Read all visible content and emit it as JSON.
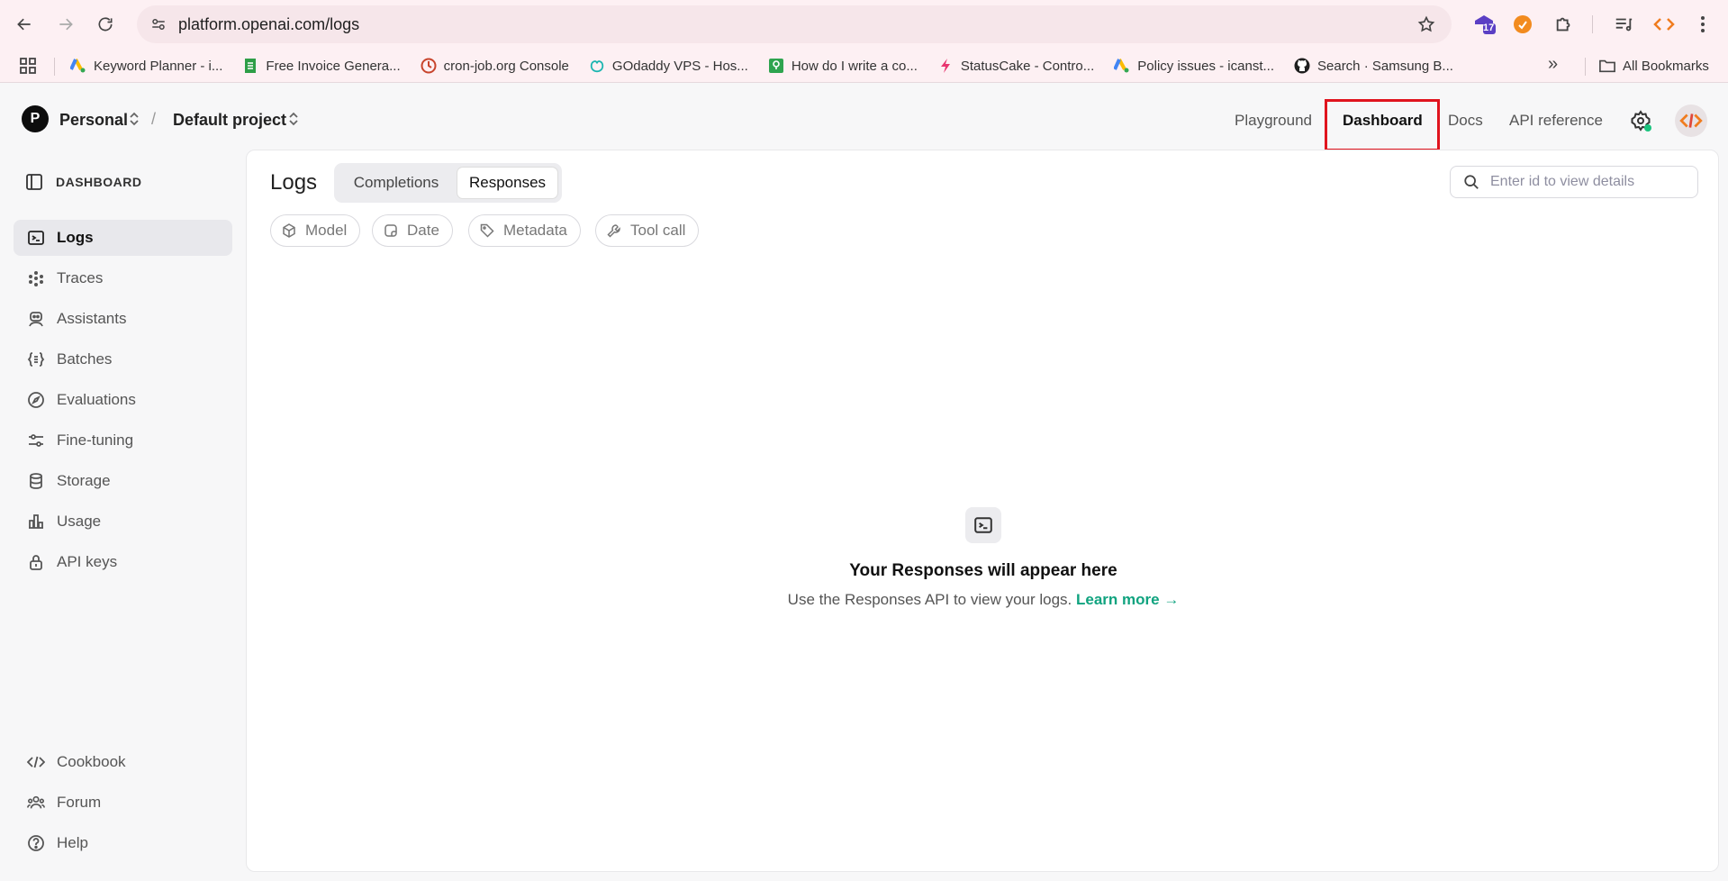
{
  "browser": {
    "url": "platform.openai.com/logs",
    "extension_badge": "17",
    "bookmarks": [
      {
        "label": "Keyword Planner - i...",
        "icon": "google-ads-icon"
      },
      {
        "label": "Free Invoice Genera...",
        "icon": "invoice-icon"
      },
      {
        "label": "cron-job.org Console",
        "icon": "cron-job-icon"
      },
      {
        "label": "GOdaddy VPS - Hos...",
        "icon": "godaddy-icon"
      },
      {
        "label": "How do I write a co...",
        "icon": "question-icon"
      },
      {
        "label": "StatusCake - Contro...",
        "icon": "statuscake-icon"
      },
      {
        "label": "Policy issues - icanst...",
        "icon": "google-ads-icon"
      },
      {
        "label": "Search · Samsung B...",
        "icon": "github-icon"
      }
    ],
    "overflow_label": "»",
    "all_bookmarks": "All Bookmarks"
  },
  "header": {
    "org_initial": "P",
    "org_name": "Personal",
    "separator": "/",
    "project_name": "Default project",
    "links": {
      "playground": "Playground",
      "dashboard": "Dashboard",
      "docs": "Docs",
      "api_reference": "API reference"
    }
  },
  "sidebar": {
    "title": "DASHBOARD",
    "items": [
      {
        "label": "Logs",
        "icon": "terminal-icon"
      },
      {
        "label": "Traces",
        "icon": "traces-icon"
      },
      {
        "label": "Assistants",
        "icon": "robot-icon"
      },
      {
        "label": "Batches",
        "icon": "braces-icon"
      },
      {
        "label": "Evaluations",
        "icon": "compass-icon"
      },
      {
        "label": "Fine-tuning",
        "icon": "sliders-icon"
      },
      {
        "label": "Storage",
        "icon": "database-icon"
      },
      {
        "label": "Usage",
        "icon": "bar-chart-icon"
      },
      {
        "label": "API keys",
        "icon": "lock-icon"
      }
    ],
    "bottom_items": [
      {
        "label": "Cookbook",
        "icon": "code-icon"
      },
      {
        "label": "Forum",
        "icon": "users-icon"
      },
      {
        "label": "Help",
        "icon": "help-icon"
      }
    ]
  },
  "main": {
    "title": "Logs",
    "tabs": {
      "completions": "Completions",
      "responses": "Responses"
    },
    "search_placeholder": "Enter id to view details",
    "filters": {
      "model": "Model",
      "date": "Date",
      "metadata": "Metadata",
      "tool_call": "Tool call"
    },
    "empty_title": "Your Responses will appear here",
    "empty_desc": "Use the Responses API to view your logs.",
    "learn_more": "Learn more →"
  },
  "colors": {
    "accent": "#10a37f",
    "highlight": "#e0141e"
  }
}
